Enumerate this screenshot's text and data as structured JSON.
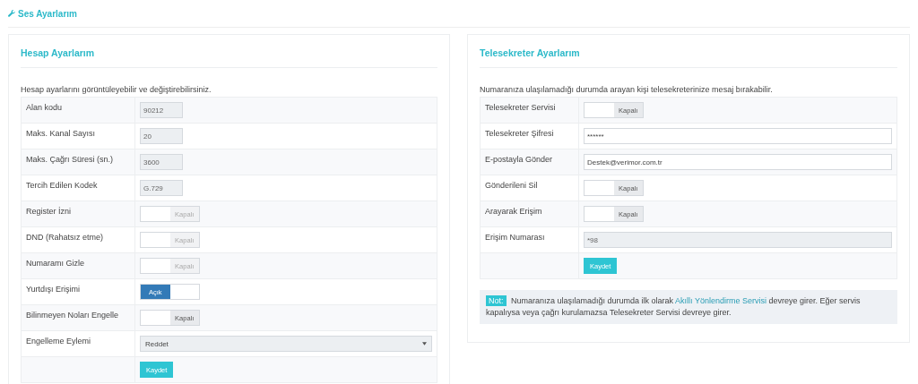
{
  "page_title": "Ses Ayarlarım",
  "account": {
    "title": "Hesap Ayarlarım",
    "description": "Hesap ayarlarını görüntüleyebilir ve değiştirebilirsiniz.",
    "rows": [
      {
        "kind": "readonly",
        "label": "Alan kodu",
        "value": "90212"
      },
      {
        "kind": "readonly",
        "label": "Maks. Kanal Sayısı",
        "value": "20"
      },
      {
        "kind": "readonly",
        "label": "Maks. Çağrı Süresi (sn.)",
        "value": "3600"
      },
      {
        "kind": "readonly",
        "label": "Tercih Edilen Kodek",
        "value": "G.729"
      },
      {
        "kind": "toggle",
        "label": "Register İzni",
        "state_text": "Kapalı",
        "on": false,
        "disabled": true
      },
      {
        "kind": "toggle",
        "label": "DND (Rahatsız etme)",
        "state_text": "Kapalı",
        "on": false,
        "disabled": true
      },
      {
        "kind": "toggle",
        "label": "Numaramı Gizle",
        "state_text": "Kapalı",
        "on": false,
        "disabled": true
      },
      {
        "kind": "toggle",
        "label": "Yurtdışı Erişimi",
        "state_text": "Açık",
        "on": true,
        "disabled": false
      },
      {
        "kind": "toggle",
        "label": "Bilinmeyen Noları Engelle",
        "state_text": "Kapalı",
        "on": false,
        "disabled": false
      },
      {
        "kind": "select",
        "label": "Engelleme Eylemi",
        "value": "Reddet"
      },
      {
        "kind": "button",
        "button": "Kaydet"
      }
    ]
  },
  "voicemail": {
    "title": "Telesekreter Ayarlarım",
    "description": "Numaranıza ulaşılamadığı durumda arayan kişi telesekreterinize mesaj bırakabilir.",
    "rows": [
      {
        "kind": "toggle",
        "label": "Telesekreter Servisi",
        "state_text": "Kapalı",
        "on": false,
        "disabled": false
      },
      {
        "kind": "input",
        "label": "Telesekreter Şifresi",
        "value": "******"
      },
      {
        "kind": "input",
        "label": "E-postayla Gönder",
        "value": "Destek@verimor.com.tr"
      },
      {
        "kind": "toggle",
        "label": "Gönderileni Sil",
        "state_text": "Kapalı",
        "on": false,
        "disabled": false
      },
      {
        "kind": "toggle",
        "label": "Arayarak Erişim",
        "state_text": "Kapalı",
        "on": false,
        "disabled": false
      },
      {
        "kind": "readonly_wide",
        "label": "Erişim Numarası",
        "value": "*98"
      },
      {
        "kind": "button",
        "button": "Kaydet"
      }
    ],
    "note": {
      "badge": "Not:",
      "text_before": "Numaranıza ulaşılamadığı durumda ilk olarak",
      "link": "Akıllı Yönlendirme Servisi",
      "text_after": "devreye girer. Eğer servis kapalıysa veya çağrı kurulamazsa Telesekreter Servisi devreye girer."
    }
  }
}
